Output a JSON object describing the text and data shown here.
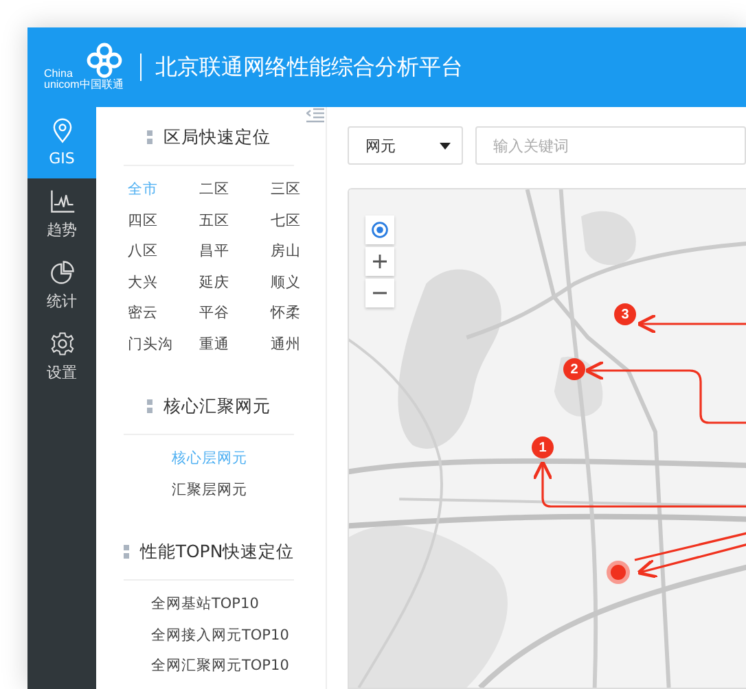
{
  "header": {
    "logo": {
      "line1": "China",
      "line2": "unicom中国联通"
    },
    "title": "北京联通网络性能综合分析平台"
  },
  "nav": [
    {
      "label": "GIS",
      "kind": "pin",
      "selected": true
    },
    {
      "label": "趋势",
      "kind": "trend",
      "selected": false
    },
    {
      "label": "统计",
      "kind": "pie",
      "selected": false
    },
    {
      "label": "设置",
      "kind": "gear",
      "selected": false
    }
  ],
  "panel": {
    "sections": [
      {
        "title": "区局快速定位",
        "kind": "grid",
        "items": [
          {
            "label": "全市",
            "selected": true
          },
          {
            "label": "二区",
            "selected": false
          },
          {
            "label": "三区",
            "selected": false
          },
          {
            "label": "四区",
            "selected": false
          },
          {
            "label": "五区",
            "selected": false
          },
          {
            "label": "七区",
            "selected": false
          },
          {
            "label": "八区",
            "selected": false
          },
          {
            "label": "昌平",
            "selected": false
          },
          {
            "label": "房山",
            "selected": false
          },
          {
            "label": "大兴",
            "selected": false
          },
          {
            "label": "延庆",
            "selected": false
          },
          {
            "label": "顺义",
            "selected": false
          },
          {
            "label": "密云",
            "selected": false
          },
          {
            "label": "平谷",
            "selected": false
          },
          {
            "label": "怀柔",
            "selected": false
          },
          {
            "label": "门头沟",
            "selected": false
          },
          {
            "label": "重通",
            "selected": false
          },
          {
            "label": "通州",
            "selected": false
          }
        ]
      },
      {
        "title": "核心汇聚网元",
        "kind": "indented",
        "items": [
          {
            "label": "核心层网元",
            "selected": true
          },
          {
            "label": "汇聚层网元",
            "selected": false
          }
        ]
      },
      {
        "title": "性能TOPN快速定位",
        "kind": "list",
        "items": [
          {
            "label": "全网基站TOP10",
            "selected": false
          },
          {
            "label": "全网接入网元TOP10",
            "selected": false
          },
          {
            "label": "全网汇聚网元TOP10",
            "selected": false
          }
        ]
      }
    ]
  },
  "toolbar": {
    "dropdown": {
      "value": "网元"
    },
    "search": {
      "placeholder": "输入关键词"
    }
  },
  "map": {
    "kind": "picture",
    "markers": [
      {
        "label": "3"
      },
      {
        "label": "2"
      },
      {
        "label": "1"
      }
    ]
  }
}
